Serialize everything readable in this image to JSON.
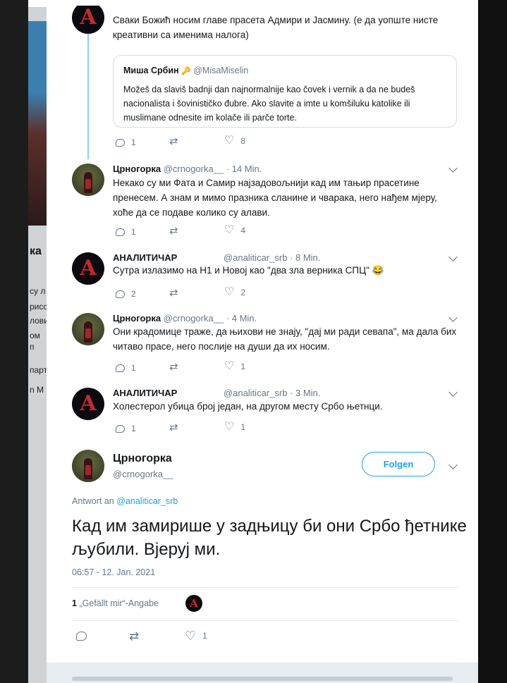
{
  "background": {
    "left_name": "ка",
    "left_lines": [
      "су л",
      "рисс",
      "лови",
      "ом п",
      "парт",
      "n M"
    ]
  },
  "colors": {
    "link": "#1da1f2",
    "thread": "#8ecdf0",
    "avatar_accent": "#c7282e"
  },
  "first_tweet": {
    "text": "Сваки Божић носим главе прасета Адмири и Јасмину. (е да уопште нисте креативни са именима налога)",
    "quote": {
      "name": "Миша Србин",
      "handle": "@MisaMiselin",
      "text": "Možeš da slaviš badnji dan najnormalnije kao čovek i vernik a da ne budeš nacionalista i šovinističko đubre. Ako slavite a imte u komšiluku katolike ili muslimane odnesite im kolače ili parče torte."
    },
    "replies": "1",
    "retweets": "",
    "likes": "8"
  },
  "tweets": [
    {
      "name": "Црногорка",
      "handle": "@crnogorka__",
      "time": "· 14 Min.",
      "text": "Некако су ми Фата и Самир  најзадовољнији кад им тањир прасетине пренесем. А знам и мимо празника сланине и чварака, него нађем мјеру, хоће да се подаве колико су алави.",
      "replies": "1",
      "retweets": "",
      "likes": "4"
    },
    {
      "name": "АНАЛИТИЧАР",
      "handle": "@analiticar_srb",
      "time": "· 8 Min.",
      "text": "Сутра излазимо на Н1 и Новој као \"два зла верника СПЦ\" 😂",
      "replies": "2",
      "retweets": "",
      "likes": "2"
    },
    {
      "name": "Црногорка",
      "handle": "@crnogorka__",
      "time": "· 4 Min.",
      "text": "Они крадомице траже, да њихови не знају, \"дај ми ради севапа\", ма дала бих читаво прасе, него послије на души да их носим.",
      "replies": "1",
      "retweets": "",
      "likes": "1"
    },
    {
      "name": "АНАЛИТИЧАР",
      "handle": "@analiticar_srb",
      "time": "· 3 Min.",
      "text": "Холестерол убица број један, на другом месту Србо њетнци.",
      "replies": "1",
      "retweets": "",
      "likes": "1"
    }
  ],
  "main": {
    "name": "Црногорка",
    "handle": "@crnogorka__",
    "follow_label": "Folgen",
    "reply_prefix": "Antwort an",
    "reply_handle": "@analiticar_srb",
    "text": "Кад им замирише у задњицу би они Србо ђетнике љубили. Вјеруј ми.",
    "timestamp": "06:57 - 12. Jan. 2021",
    "likes_count": "1",
    "likes_label": "„Gefällt mir“-Angabe",
    "replies": "",
    "retweets": "",
    "likes": "1"
  }
}
